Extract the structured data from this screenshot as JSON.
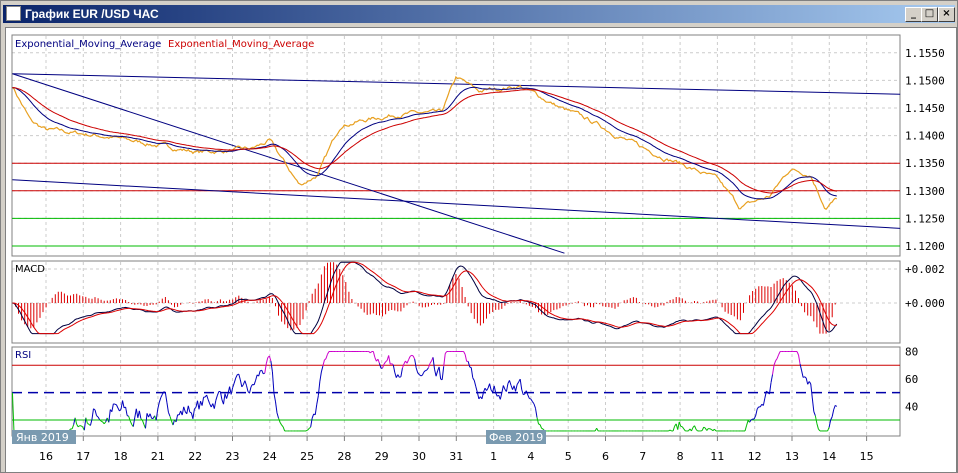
{
  "window": {
    "title": "График EUR /USD  ЧАС",
    "buttons": {
      "minimize": "_",
      "maximize": "□",
      "close": "×"
    }
  },
  "legend": {
    "ema1": "Exponential_Moving_Average",
    "ema2": "Exponential_Moving_Average"
  },
  "colors": {
    "price": "#e8a020",
    "ema_fast": "#000080",
    "ema_slow": "#cc0000",
    "trend": "#000080",
    "resistance": "#cc0000",
    "support": "#00bb00",
    "macd": "#000040",
    "signal": "#dd0000",
    "rsi": "#0000bb",
    "rsi_ob": "#cc00cc",
    "rsi_os": "#00bb00"
  },
  "chart_data": [
    {
      "type": "line",
      "title": "EUR/USD H1",
      "ylim": [
        1.1175,
        1.1565
      ],
      "yticks": [
        "1.1550",
        "1.1500",
        "1.1450",
        "1.1400",
        "1.1350",
        "1.1300",
        "1.1250",
        "1.1200"
      ],
      "price_keypoints": [
        [
          -0.9,
          1.149
        ],
        [
          -0.4,
          1.1425
        ],
        [
          0,
          1.141
        ],
        [
          1.45,
          1.14
        ],
        [
          2.8,
          1.1385
        ],
        [
          4.1,
          1.137
        ],
        [
          5.5,
          1.1375
        ],
        [
          6,
          1.139
        ],
        [
          6.8,
          1.131
        ],
        [
          7.3,
          1.133
        ],
        [
          7.9,
          1.142
        ],
        [
          9.5,
          1.144
        ],
        [
          10.6,
          1.144
        ],
        [
          11,
          1.1505
        ],
        [
          11.6,
          1.148
        ],
        [
          12.7,
          1.149
        ],
        [
          13.8,
          1.145
        ],
        [
          14.8,
          1.142
        ],
        [
          15.9,
          1.138
        ],
        [
          17,
          1.135
        ],
        [
          18,
          1.132
        ],
        [
          18.6,
          1.127
        ],
        [
          19.4,
          1.129
        ],
        [
          19.95,
          1.134
        ],
        [
          20.5,
          1.133
        ],
        [
          20.9,
          1.127
        ],
        [
          21.2,
          1.1285
        ]
      ],
      "trendlines": [
        [
          [
            -0.9,
            1.1512
          ],
          [
            22.9,
            1.1475
          ]
        ],
        [
          [
            -0.9,
            1.1512
          ],
          [
            13.9,
            1.1187
          ]
        ],
        [
          [
            -0.9,
            1.132
          ],
          [
            22.9,
            1.1232
          ]
        ]
      ],
      "hlines": {
        "resistance": [
          1.135,
          1.13
        ],
        "support": [
          1.125,
          1.12
        ]
      },
      "legend": [
        "Exponential_Moving_Average",
        "Exponential_Moving_Average"
      ]
    },
    {
      "type": "line",
      "title": "MACD",
      "yticks": [
        "+0.002",
        "+0.000"
      ],
      "ylim": [
        -0.002,
        0.0025
      ]
    },
    {
      "type": "line",
      "title": "RSI",
      "yticks": [
        "80",
        "60",
        "40"
      ],
      "levels": [
        70,
        50,
        30
      ],
      "ylim": [
        20,
        82
      ]
    }
  ],
  "xaxis": {
    "ticks": [
      "16",
      "17",
      "18",
      "21",
      "22",
      "23",
      "24",
      "25",
      "28",
      "29",
      "30",
      "31",
      "1",
      "4",
      "5",
      "6",
      "7",
      "8",
      "11",
      "12",
      "13",
      "14",
      "15"
    ],
    "months": [
      "Янв 2019",
      "Фев 2019"
    ]
  }
}
